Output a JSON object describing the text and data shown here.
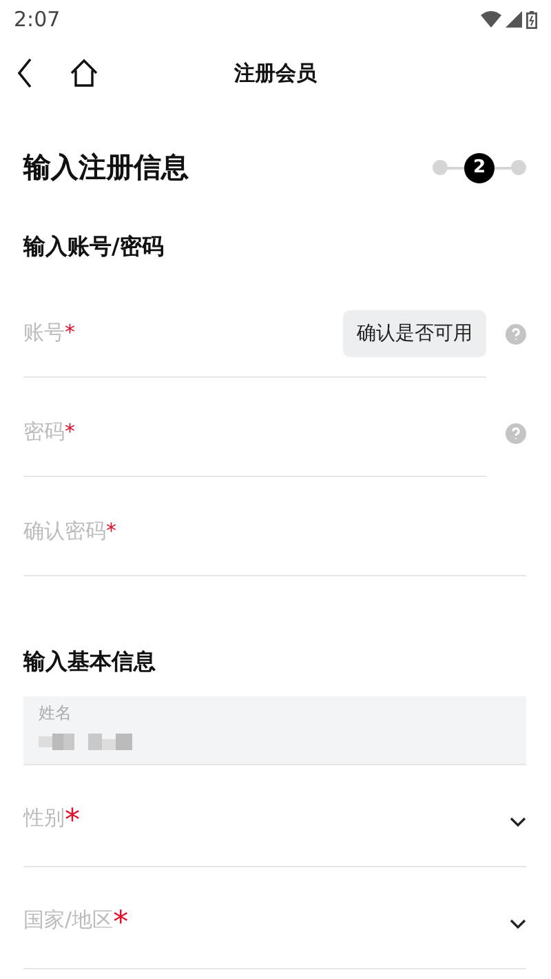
{
  "status_bar": {
    "time": "2:07"
  },
  "header": {
    "title": "注册会员"
  },
  "page_title": "输入注册信息",
  "steps": [
    {
      "selected": false
    },
    {
      "selected": true,
      "label": "2"
    },
    {
      "selected": false
    }
  ],
  "sections": [
    {
      "heading": "输入账号/密码",
      "fields": [
        {
          "kind": "text",
          "label": "账号",
          "mark": "*",
          "button": "确认是否可用",
          "help": true
        },
        {
          "kind": "text",
          "label": "密码",
          "mark": "*",
          "help": true
        },
        {
          "kind": "text",
          "label": "确认密码",
          "mark": "*",
          "help": false
        }
      ]
    },
    {
      "heading": "输入基本信息",
      "fields": [
        {
          "kind": "filled",
          "label": "姓名",
          "blurred": true
        },
        {
          "kind": "select",
          "label": "性别",
          "mark": "*"
        },
        {
          "kind": "select",
          "label": "国家/地区",
          "mark": "*"
        }
      ]
    }
  ]
}
